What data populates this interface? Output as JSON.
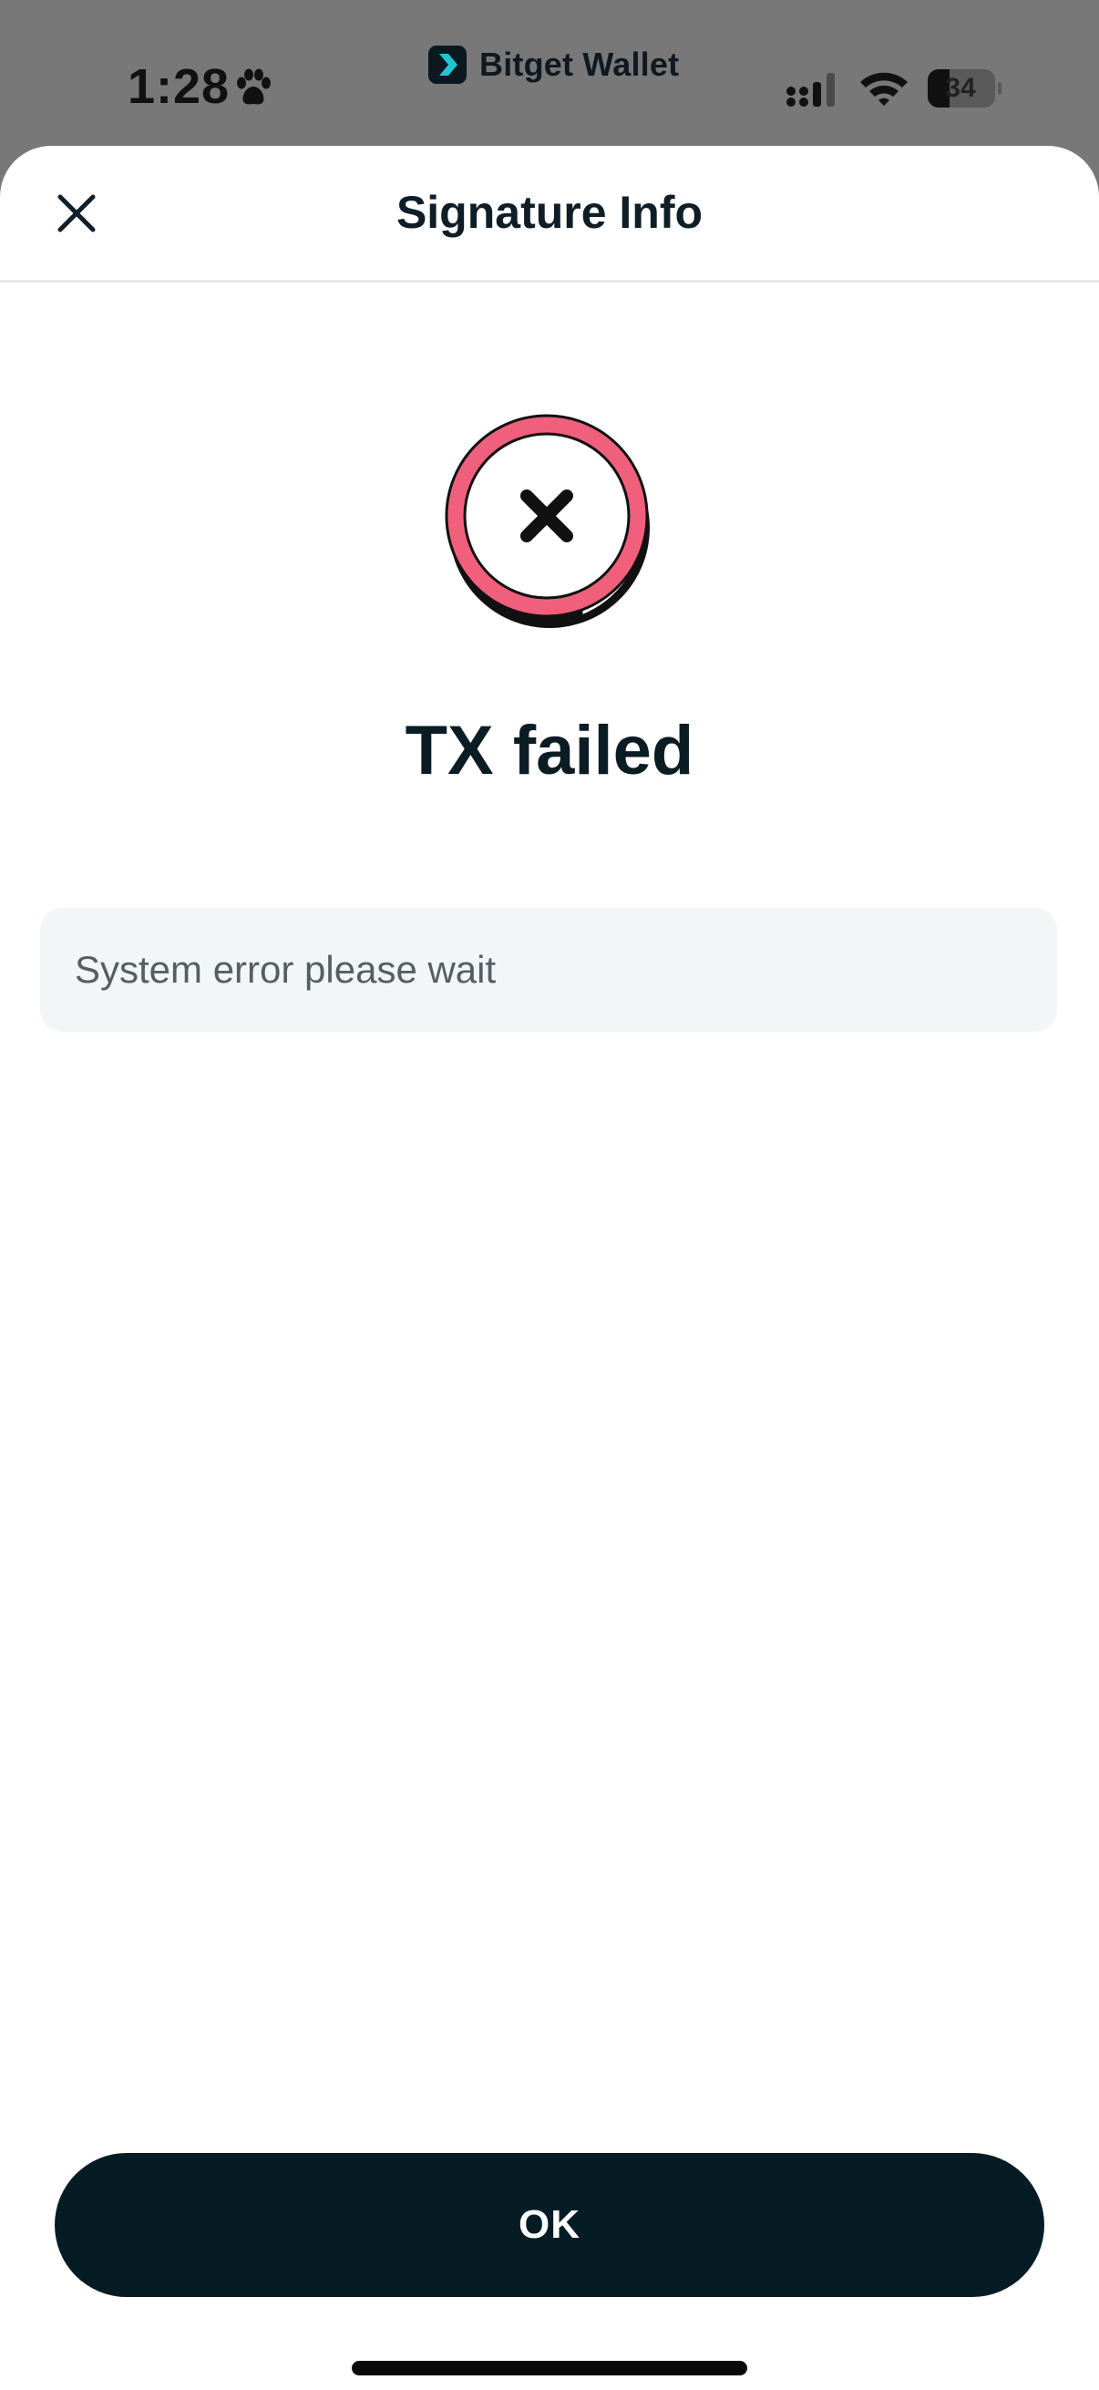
{
  "status_bar": {
    "time": "1:28",
    "app_name": "Bitget Wallet",
    "battery_level": "34",
    "icons": [
      "paw-icon",
      "bitget-logo-icon",
      "cellular-signal-icon",
      "wifi-icon",
      "battery-icon"
    ]
  },
  "sheet": {
    "title": "Signature Info",
    "close_icon": "close-icon"
  },
  "result": {
    "status_icon": "fail-badge-icon",
    "title": "TX failed",
    "message": "System error please wait"
  },
  "actions": {
    "ok_label": "OK"
  },
  "colors": {
    "accent_fail": "#F0607C",
    "primary_button": "#061C24",
    "title_text": "#0C1C24",
    "error_box_bg": "#F3F6F7",
    "brand_teal": "#1FC7D4"
  }
}
